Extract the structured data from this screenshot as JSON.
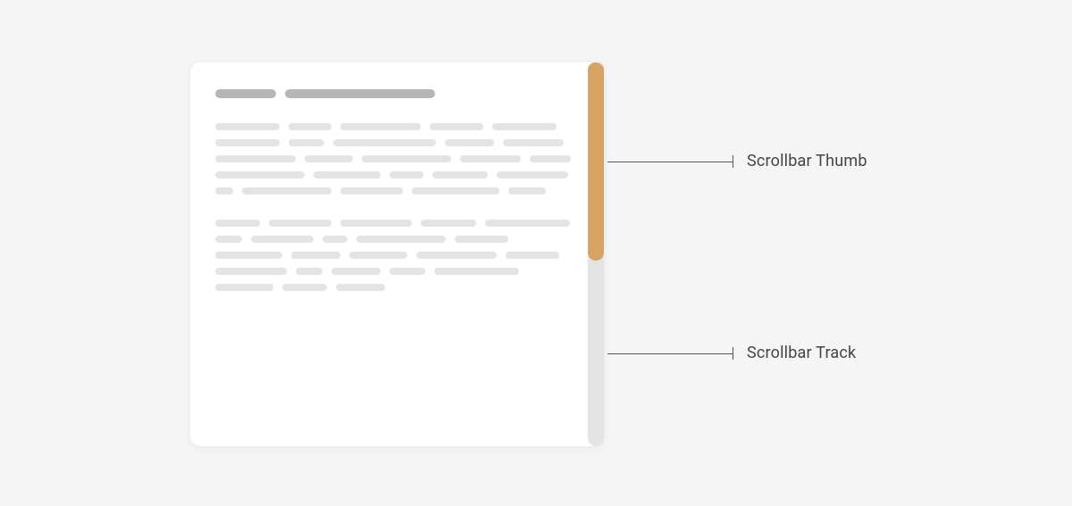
{
  "annotations": {
    "thumb": "Scrollbar Thumb",
    "track": "Scrollbar Track"
  },
  "colors": {
    "scrollbar_thumb": "#d7a362",
    "scrollbar_track": "#e4e4e4",
    "card_bg": "#ffffff",
    "page_bg": "#f5f5f5",
    "text_placeholder_dark": "#b6b6b6",
    "text_placeholder_light": "#e4e4e4",
    "annotation_line": "#555555",
    "annotation_text": "#444444"
  }
}
